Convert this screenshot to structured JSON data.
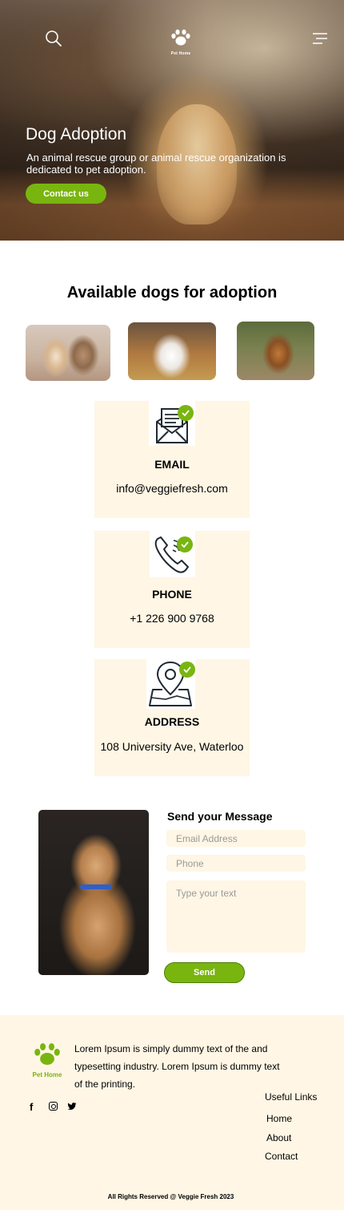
{
  "header": {
    "brand": "Pet Home",
    "search_icon": "search-icon",
    "menu_icon": "hamburger-menu-icon",
    "logo_icon": "paw-icon"
  },
  "hero": {
    "title": "Dog Adoption",
    "text": "An animal rescue group or animal rescue organization is dedicated to pet adoption.",
    "button_label": "Contact us"
  },
  "available": {
    "title": "Available dogs for adoption"
  },
  "contact_cards": {
    "email": {
      "label": "EMAIL",
      "value": "info@veggiefresh.com",
      "icon": "envelope-icon"
    },
    "phone": {
      "label": "PHONE",
      "value": "+1 226 900 9768",
      "icon": "phone-icon"
    },
    "address": {
      "label": "ADDRESS",
      "value": "108 University Ave, Waterloo",
      "icon": "map-pin-icon"
    }
  },
  "message_form": {
    "title": "Send your Message",
    "email_placeholder": "Email Address",
    "phone_placeholder": "Phone",
    "text_placeholder": "Type your text",
    "send_label": "Send"
  },
  "footer": {
    "brand": "Pet Home",
    "about": "Lorem Ipsum is simply dummy text of the and typesetting industry. Lorem Ipsum is dummy text of the printing.",
    "social": {
      "facebook": "f"
    },
    "useful_links_title": "Useful Links",
    "links": [
      "Home",
      "About",
      "Contact"
    ],
    "copyright": "All Rights Reserved @ Veggie Fresh 2023"
  },
  "colors": {
    "accent": "#79b50f",
    "cream": "#fff6e5"
  }
}
